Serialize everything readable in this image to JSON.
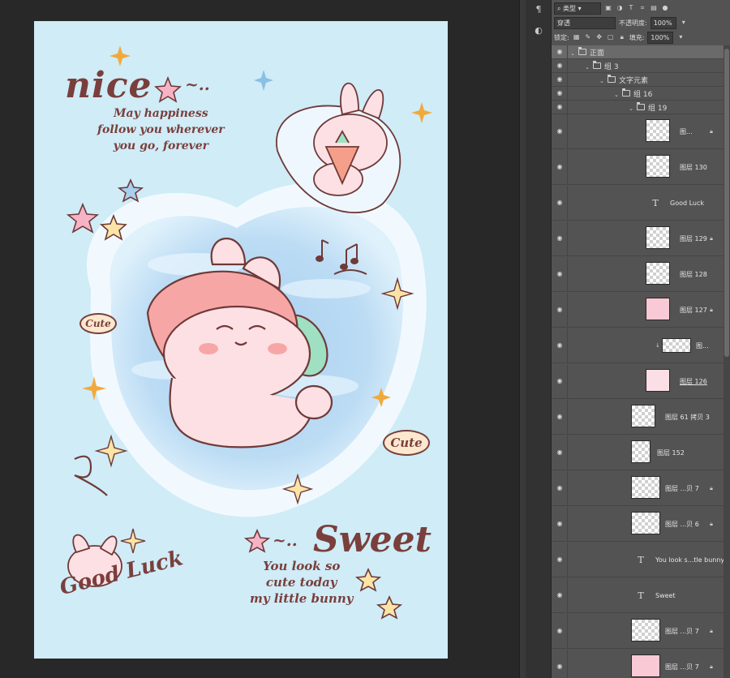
{
  "artwork": {
    "nice_word": "nice",
    "nice_tilde": "~..",
    "nice_lines": [
      "May happiness",
      "follow you wherever",
      "you go, forever"
    ],
    "sweet_word": "Sweet",
    "sweet_tilde": "~..",
    "sweet_lines": [
      "You look so",
      "cute today",
      "my little bunny"
    ],
    "good_luck": "Good Luck",
    "cute_left": "Cute",
    "cute_right": "Cute"
  },
  "panel": {
    "filter_label": "类型",
    "blend_mode": "穿透",
    "opacity_label": "不透明度:",
    "opacity_value": "100%",
    "lock_label": "锁定:",
    "fill_label": "填充:",
    "fill_value": "100%"
  },
  "groups": [
    {
      "label": "正面"
    },
    {
      "label": "组 3"
    },
    {
      "label": "文字元素"
    },
    {
      "label": "组 16"
    },
    {
      "label": "组 19"
    }
  ],
  "layers": [
    {
      "label": "图...",
      "kind": "raster",
      "locked": true
    },
    {
      "label": "图层 130",
      "kind": "raster",
      "locked": false
    },
    {
      "label": "Good Luck",
      "kind": "text",
      "locked": false
    },
    {
      "label": "图层 129",
      "kind": "raster",
      "locked": true
    },
    {
      "label": "图层 128",
      "kind": "raster",
      "locked": false
    },
    {
      "label": "图层 127",
      "kind": "raster",
      "locked": true
    },
    {
      "label": "图...",
      "kind": "raster",
      "locked": false
    },
    {
      "label": "图层 126",
      "kind": "raster",
      "locked": false
    },
    {
      "label": "图层 61 拷贝 3",
      "kind": "raster",
      "locked": false
    },
    {
      "label": "图层 152",
      "kind": "raster",
      "locked": false
    },
    {
      "label": "图层 ...贝 7",
      "kind": "raster",
      "locked": true
    },
    {
      "label": "图层 ...贝 6",
      "kind": "raster",
      "locked": true
    },
    {
      "label": "You look s...tle bunny",
      "kind": "text",
      "locked": false
    },
    {
      "label": "Sweet",
      "kind": "text",
      "locked": false
    },
    {
      "label": "图层 ...贝 7",
      "kind": "raster",
      "locked": true
    },
    {
      "label": "图层 ...贝 7",
      "kind": "raster",
      "locked": true
    }
  ],
  "colors": {
    "canvas_bg": "#cfecf7",
    "ink": "#7a3f3c",
    "panel_bg": "#535353",
    "app_bg": "#282828"
  }
}
